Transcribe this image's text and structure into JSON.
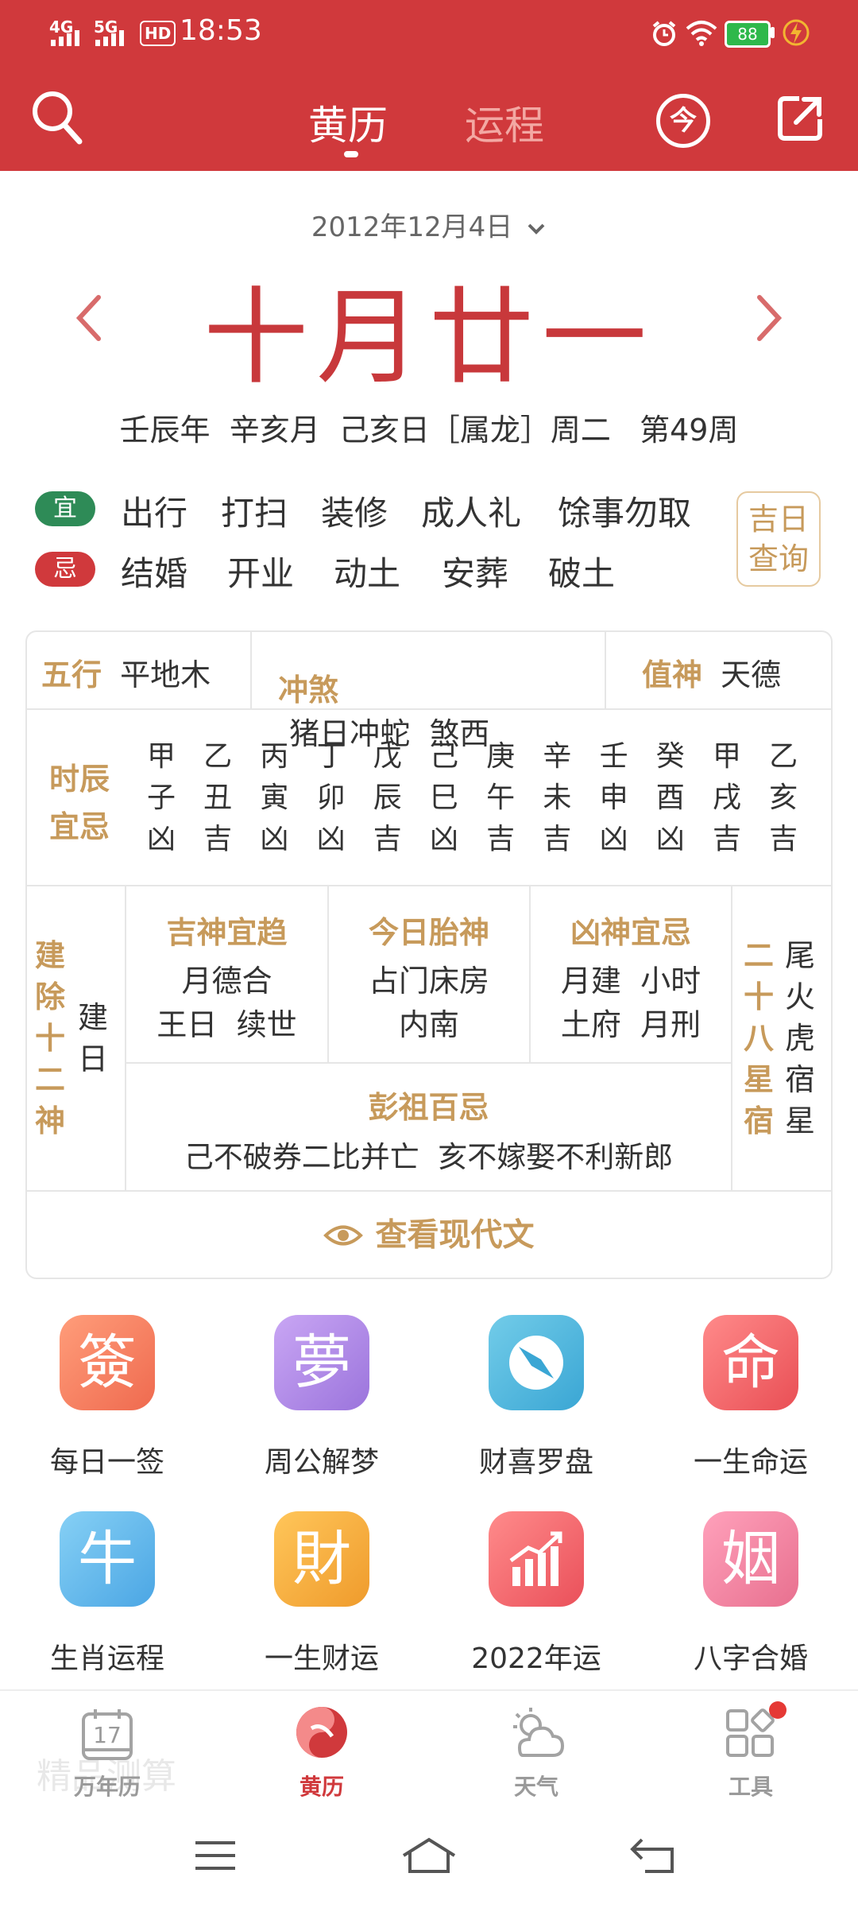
{
  "status_bar": {
    "signal_left": "4G",
    "signal_mid": "5G",
    "hd": "HD",
    "time": "18:53",
    "battery": "88"
  },
  "header": {
    "tabs": [
      {
        "label": "黄历",
        "active": true
      },
      {
        "label": "运程",
        "active": false
      }
    ],
    "today_glyph": "今",
    "colors": {
      "bar": "#d0393c",
      "inactive_tab": "#f3a8a3"
    }
  },
  "date_selector": {
    "solar_date": "2012年12月4日",
    "lunar_date": "十月廿一",
    "ganzhi_line": "壬辰年  辛亥月  己亥日［属龙］周二   第49周"
  },
  "yiji": {
    "yi_label": "宜",
    "yi_items": [
      "出行",
      "打扫",
      "装修",
      "成人礼",
      "馀事勿取"
    ],
    "ji_label": "忌",
    "ji_items": [
      "结婚",
      "开业",
      "动土",
      "安葬",
      "破土"
    ],
    "jiri_button": [
      "吉日",
      "查询"
    ],
    "colors": {
      "yi": "#2e8b57",
      "ji": "#d0393c"
    }
  },
  "almanac": {
    "wuxing": {
      "label": "五行",
      "value": "平地木"
    },
    "chongsha": {
      "label": "冲煞",
      "value": "猪日冲蛇  煞西"
    },
    "zhishen": {
      "label": "值神",
      "value": "天德"
    },
    "shichen": {
      "label": [
        "时辰",
        "宜忌"
      ],
      "hours": [
        [
          "甲",
          "子",
          "凶"
        ],
        [
          "乙",
          "丑",
          "吉"
        ],
        [
          "丙",
          "寅",
          "凶"
        ],
        [
          "丁",
          "卯",
          "凶"
        ],
        [
          "戊",
          "辰",
          "吉"
        ],
        [
          "己",
          "巳",
          "凶"
        ],
        [
          "庚",
          "午",
          "吉"
        ],
        [
          "辛",
          "未",
          "吉"
        ],
        [
          "壬",
          "申",
          "凶"
        ],
        [
          "癸",
          "酉",
          "凶"
        ],
        [
          "甲",
          "戌",
          "吉"
        ],
        [
          "乙",
          "亥",
          "吉"
        ]
      ]
    },
    "jianchu": {
      "label": [
        "建",
        "除",
        "十",
        "二",
        "神"
      ],
      "value": [
        "建",
        "日"
      ]
    },
    "jishen": {
      "label": "吉神宜趋",
      "lines": [
        "月德合",
        "王日  续世"
      ]
    },
    "taishen": {
      "label": "今日胎神",
      "lines": [
        "占门床房",
        "内南"
      ]
    },
    "xiongshen": {
      "label": "凶神宜忌",
      "lines": [
        "月建  小时",
        "土府  月刑"
      ]
    },
    "xingxiu": {
      "label": [
        "二",
        "十",
        "八",
        "星",
        "宿"
      ],
      "value": [
        "尾",
        "火",
        "虎",
        "宿",
        "星"
      ]
    },
    "pengzu": {
      "label": "彭祖百忌",
      "value": "己不破券二比并亡  亥不嫁娶不利新郎"
    },
    "modern_button": "查看现代文"
  },
  "tools": [
    {
      "glyph": "簽",
      "label": "每日一签",
      "color": "#f47c5a"
    },
    {
      "glyph": "夢",
      "label": "周公解梦",
      "color": "#b28be6"
    },
    {
      "glyph": "compass-icon",
      "label": "财喜罗盘",
      "color": "#4fb7de"
    },
    {
      "glyph": "命",
      "label": "一生命运",
      "color": "#ef5f5f"
    },
    {
      "glyph": "牛",
      "label": "生肖运程",
      "color": "#5cb6ea"
    },
    {
      "glyph": "財",
      "label": "一生财运",
      "color": "#f2a93b"
    },
    {
      "glyph": "chart-icon",
      "label": "2022年运",
      "color": "#ef5f68"
    },
    {
      "glyph": "姻",
      "label": "八字合婚",
      "color": "#f07d9d"
    }
  ],
  "bottom_nav": [
    {
      "label": "万年历",
      "active": false,
      "icon": "calendar-icon",
      "day": "17"
    },
    {
      "label": "黄历",
      "active": true,
      "icon": "huangli-icon"
    },
    {
      "label": "天气",
      "active": false,
      "icon": "weather-icon"
    },
    {
      "label": "工具",
      "active": false,
      "icon": "tools-icon"
    }
  ],
  "ghost_text": "精品测算"
}
